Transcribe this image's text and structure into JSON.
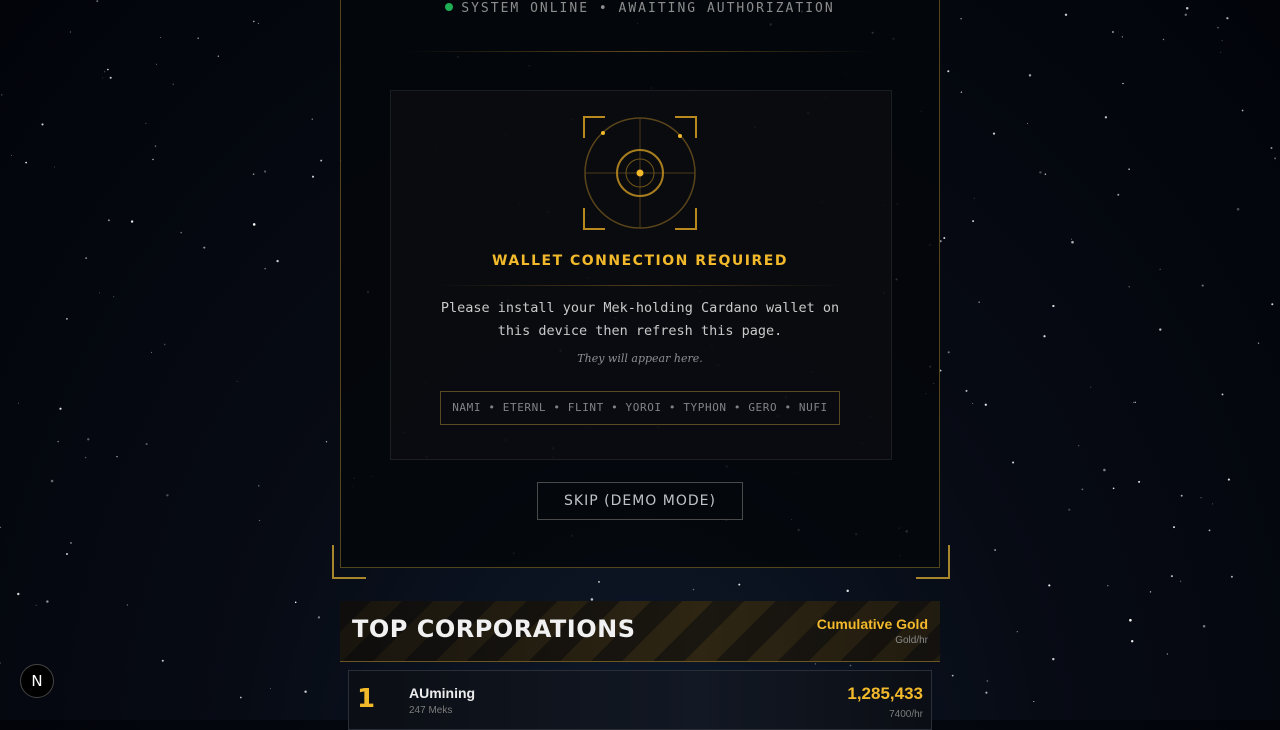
{
  "status": {
    "text": "SYSTEM ONLINE • AWAITING AUTHORIZATION",
    "indicator_color": "#1fae55"
  },
  "auth": {
    "scope_icon": "crosshair-scope-icon",
    "title": "WALLET CONNECTION REQUIRED",
    "message": "Please install your Mek-holding Cardano wallet on this device then refresh this page.",
    "hint": "They will appear here.",
    "wallet_list": "NAMI • ETERNL • FLINT • YOROI • TYPHON • GERO • NUFI",
    "skip_label": "SKIP (DEMO MODE)"
  },
  "leaderboard": {
    "title": "TOP CORPORATIONS",
    "metric_label": "Cumulative Gold",
    "metric_unit": "Gold/hr",
    "rows": [
      {
        "rank": "1",
        "name": "AUmining",
        "meks": "247 Meks",
        "gold": "1,285,433",
        "rate": "7400/hr"
      }
    ]
  },
  "badge": {
    "label": "N"
  },
  "colors": {
    "accent": "#f2b92b",
    "frame": "#a8842a"
  }
}
